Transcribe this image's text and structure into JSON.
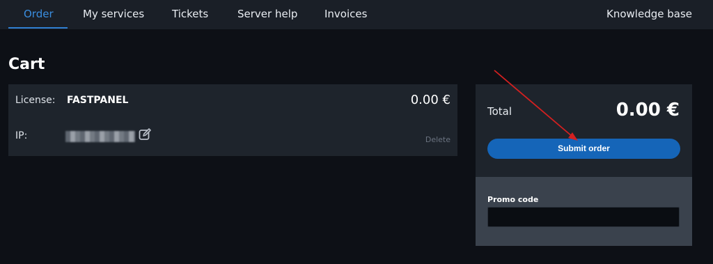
{
  "nav": {
    "tabs": [
      {
        "label": "Order",
        "active": true
      },
      {
        "label": "My services",
        "active": false
      },
      {
        "label": "Tickets",
        "active": false
      },
      {
        "label": "Server help",
        "active": false
      },
      {
        "label": "Invoices",
        "active": false
      }
    ],
    "knowledge_base": "Knowledge base"
  },
  "page": {
    "title": "Cart"
  },
  "cart_item": {
    "license_label": "License:",
    "license_value": "FASTPANEL",
    "price": "0.00 €",
    "ip_label": "IP:",
    "ip_value_state": "blurred",
    "edit_icon": "edit-icon",
    "delete_label": "Delete"
  },
  "summary": {
    "total_label": "Total",
    "total_value": "0.00 €",
    "submit_label": "Submit order",
    "promo_label": "Promo code",
    "promo_value": ""
  },
  "colors": {
    "accent": "#2f7fd2",
    "button": "#1565b8",
    "background": "#0d1016",
    "panel": "#1e242c",
    "annotation_arrow": "#d42020"
  }
}
